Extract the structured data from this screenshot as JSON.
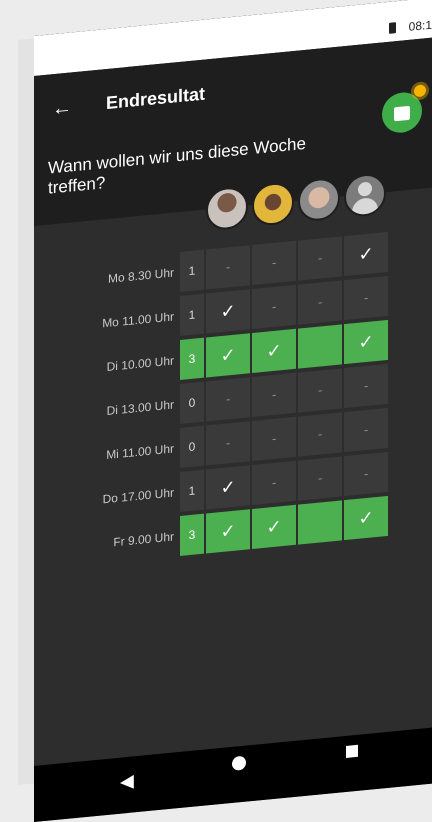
{
  "status": {
    "time": "08:1"
  },
  "header": {
    "back_icon": "←",
    "title": "Endresultat"
  },
  "question": "Wann wollen wir uns diese Woche treffen?",
  "rows": [
    {
      "label": "Mo 8.30 Uhr",
      "count": "1",
      "cells": [
        "-",
        "-",
        "-",
        "✓"
      ],
      "winner": false
    },
    {
      "label": "Mo 11.00 Uhr",
      "count": "1",
      "cells": [
        "✓",
        "-",
        "-",
        "-"
      ],
      "winner": false
    },
    {
      "label": "Di 10.00 Uhr",
      "count": "3",
      "cells": [
        "✓",
        "✓",
        "-",
        "✓"
      ],
      "winner": true
    },
    {
      "label": "Di 13.00 Uhr",
      "count": "0",
      "cells": [
        "-",
        "-",
        "-",
        "-"
      ],
      "winner": false
    },
    {
      "label": "Mi 11.00 Uhr",
      "count": "0",
      "cells": [
        "-",
        "-",
        "-",
        "-"
      ],
      "winner": false
    },
    {
      "label": "Do 17.00 Uhr",
      "count": "1",
      "cells": [
        "✓",
        "-",
        "-",
        "-"
      ],
      "winner": false
    },
    {
      "label": "Fr 9.00 Uhr",
      "count": "3",
      "cells": [
        "✓",
        "✓",
        "-",
        "✓"
      ],
      "winner": true
    }
  ],
  "nav": {
    "back": "◀"
  },
  "colors": {
    "accent": "#4caf50",
    "cell": "#3a3a3a"
  }
}
